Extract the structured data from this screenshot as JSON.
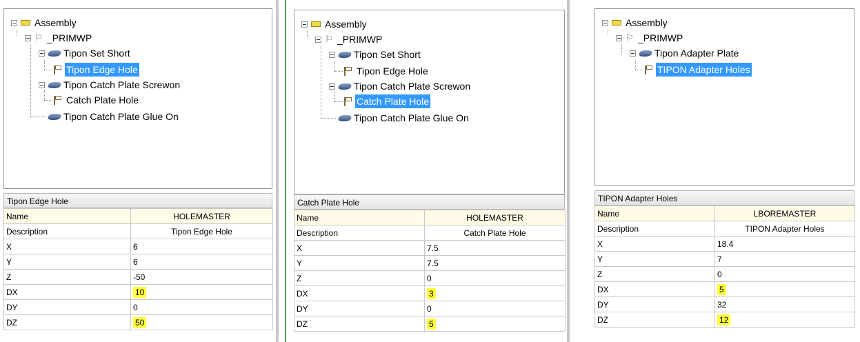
{
  "panels": [
    {
      "tree": [
        "Assembly",
        "_PRIMWP",
        "Tipon Set Short",
        "Tipon Edge Hole",
        "Tipon Catch Plate Screwon",
        "Catch Plate Hole",
        "Tipon Catch Plate Glue On"
      ],
      "selected": "Tipon Edge Hole",
      "header": "Tipon Edge Hole",
      "props": [
        {
          "key": "Name",
          "value": "HOLEMASTER"
        },
        {
          "key": "Description",
          "value": "Tipon Edge Hole"
        },
        {
          "key": "X",
          "value": "6"
        },
        {
          "key": "Y",
          "value": "6"
        },
        {
          "key": "Z",
          "value": "-50"
        },
        {
          "key": "DX",
          "value": "10"
        },
        {
          "key": "DY",
          "value": "0"
        },
        {
          "key": "DZ",
          "value": "50"
        }
      ]
    },
    {
      "tree": [
        "Assembly",
        "_PRIMWP",
        "Tipon Set Short",
        "Tipon Edge Hole",
        "Tipon Catch Plate Screwon",
        "Catch Plate Hole",
        "Tipon Catch Plate Glue On"
      ],
      "selected": "Catch Plate Hole",
      "header": "Catch Plate Hole",
      "props": [
        {
          "key": "Name",
          "value": "HOLEMASTER"
        },
        {
          "key": "Description",
          "value": "Catch Plate Hole"
        },
        {
          "key": "X",
          "value": "7.5"
        },
        {
          "key": "Y",
          "value": "7.5"
        },
        {
          "key": "Z",
          "value": "0"
        },
        {
          "key": "DX",
          "value": "3"
        },
        {
          "key": "DY",
          "value": "0"
        },
        {
          "key": "DZ",
          "value": "5"
        }
      ]
    },
    {
      "tree": [
        "Assembly",
        "_PRIMWP",
        "Tipon Adapter Plate",
        "TIPON Adapter Holes"
      ],
      "selected": "TIPON Adapter Holes",
      "header": "TIPON Adapter Holes",
      "props": [
        {
          "key": "Name",
          "value": "LBOREMASTER"
        },
        {
          "key": "Description",
          "value": "TIPON Adapter Holes"
        },
        {
          "key": "X",
          "value": "18.4"
        },
        {
          "key": "Y",
          "value": "7"
        },
        {
          "key": "Z",
          "value": "0"
        },
        {
          "key": "DX",
          "value": "5"
        },
        {
          "key": "DY",
          "value": "32"
        },
        {
          "key": "DZ",
          "value": "12"
        }
      ]
    }
  ],
  "colors": {
    "selection": "#3399ff",
    "highlight": "#ffff3a",
    "name_row": "#fffbe6"
  },
  "icons": {
    "assembly": "folder-icon",
    "workplane": "workplane-icon",
    "set": "part-icon",
    "hole": "flag-icon"
  }
}
